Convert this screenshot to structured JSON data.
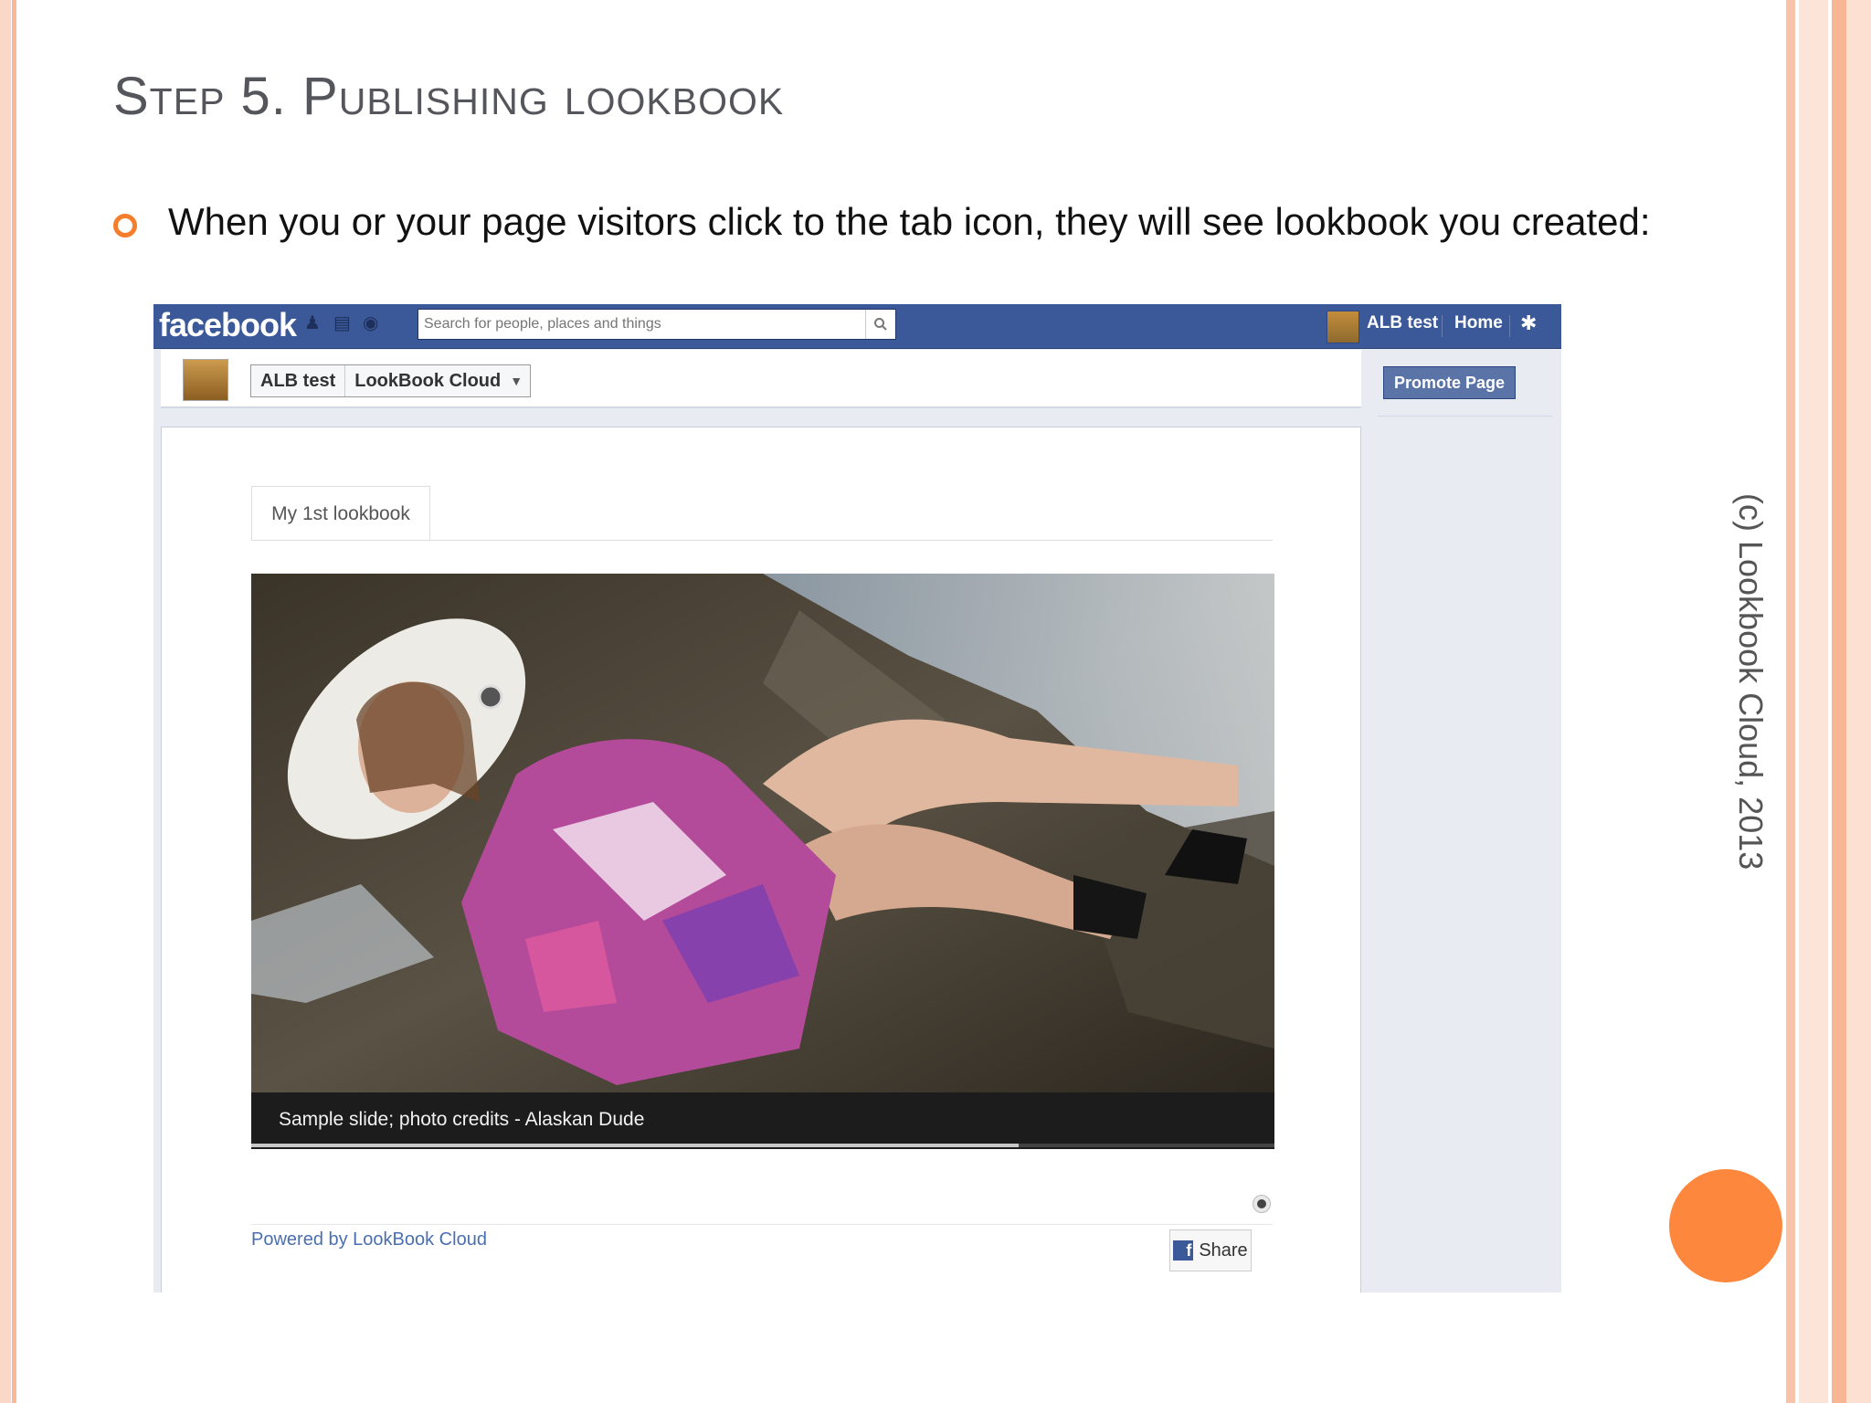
{
  "slide": {
    "title": "Step 5. Publishing lookbook",
    "bullet": "When you or your page visitors click to the tab icon, they will see lookbook you created:",
    "credit": "(c) Lookbook Cloud, 2013"
  },
  "facebook": {
    "logo": "facebook",
    "search_placeholder": "Search for people, places and things",
    "user_name": "ALB test",
    "home_label": "Home",
    "page": {
      "name": "ALB test",
      "app_name": "LookBook Cloud",
      "promote_label": "Promote Page"
    },
    "lookbook": {
      "tab_label": "My 1st lookbook",
      "caption": "Sample slide; photo credits - Alaskan Dude",
      "progress": 0.75,
      "powered_by": "Powered by LookBook Cloud",
      "share_label": "Share"
    }
  }
}
